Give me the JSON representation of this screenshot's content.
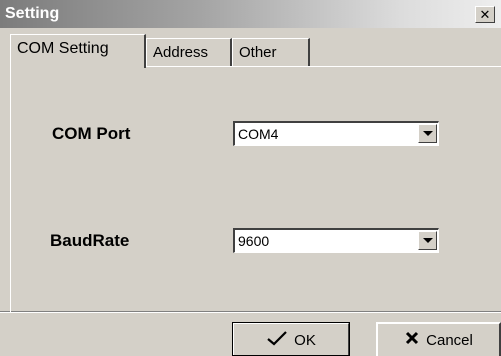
{
  "window": {
    "title": "Setting",
    "close_glyph": "✕"
  },
  "tabs": [
    {
      "label": "COM Setting",
      "active": true
    },
    {
      "label": "Address",
      "active": false
    },
    {
      "label": "Other",
      "active": false
    }
  ],
  "com_setting": {
    "com_port": {
      "label": "COM Port",
      "value": "COM4"
    },
    "baud_rate": {
      "label": "BaudRate",
      "value": "9600"
    }
  },
  "buttons": {
    "ok": {
      "label": "OK",
      "icon": "checkmark-icon"
    },
    "cancel": {
      "label": "Cancel",
      "icon": "x-icon"
    }
  }
}
